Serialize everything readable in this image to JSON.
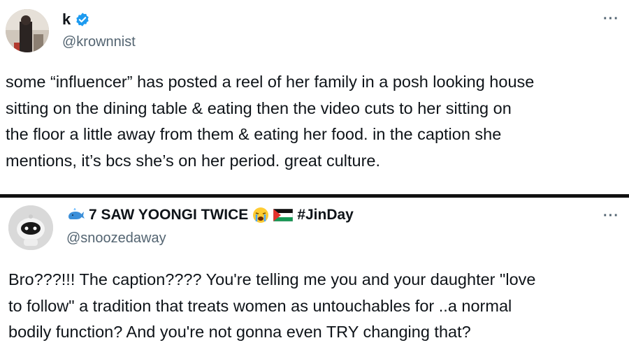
{
  "tweet1": {
    "display_name": "k",
    "handle": "@krownnist",
    "more": "···",
    "text_lines": [
      "some “influencer” has posted a reel of her family in a posh looking house",
      "sitting on the dining table & eating then the video cuts to her sitting on",
      "the floor a little away from them & eating her food. in the caption she",
      "mentions, it’s bcs she’s on her period. great culture."
    ]
  },
  "tweet2": {
    "display_name": "7 SAW YOONGI TWICE",
    "hashtag": "#JinDay",
    "handle": "@snoozedaway",
    "more": "···",
    "text_lines": [
      "Bro???!!! The caption???? You're telling me you and your daughter \"love",
      "to follow\" a tradition that treats women as untouchables for ..a normal",
      "bodily function? And you're not gonna even TRY changing that?"
    ]
  },
  "icons": {
    "verified": "verified-badge-icon",
    "whale": "whale-emoji-icon",
    "crying": "crying-face-emoji-icon",
    "flag": "palestine-flag-icon",
    "more": "more-options-icon"
  },
  "colors": {
    "verified_blue": "#1d9bf0",
    "handle_gray": "#536471",
    "text": "#0f1419"
  }
}
